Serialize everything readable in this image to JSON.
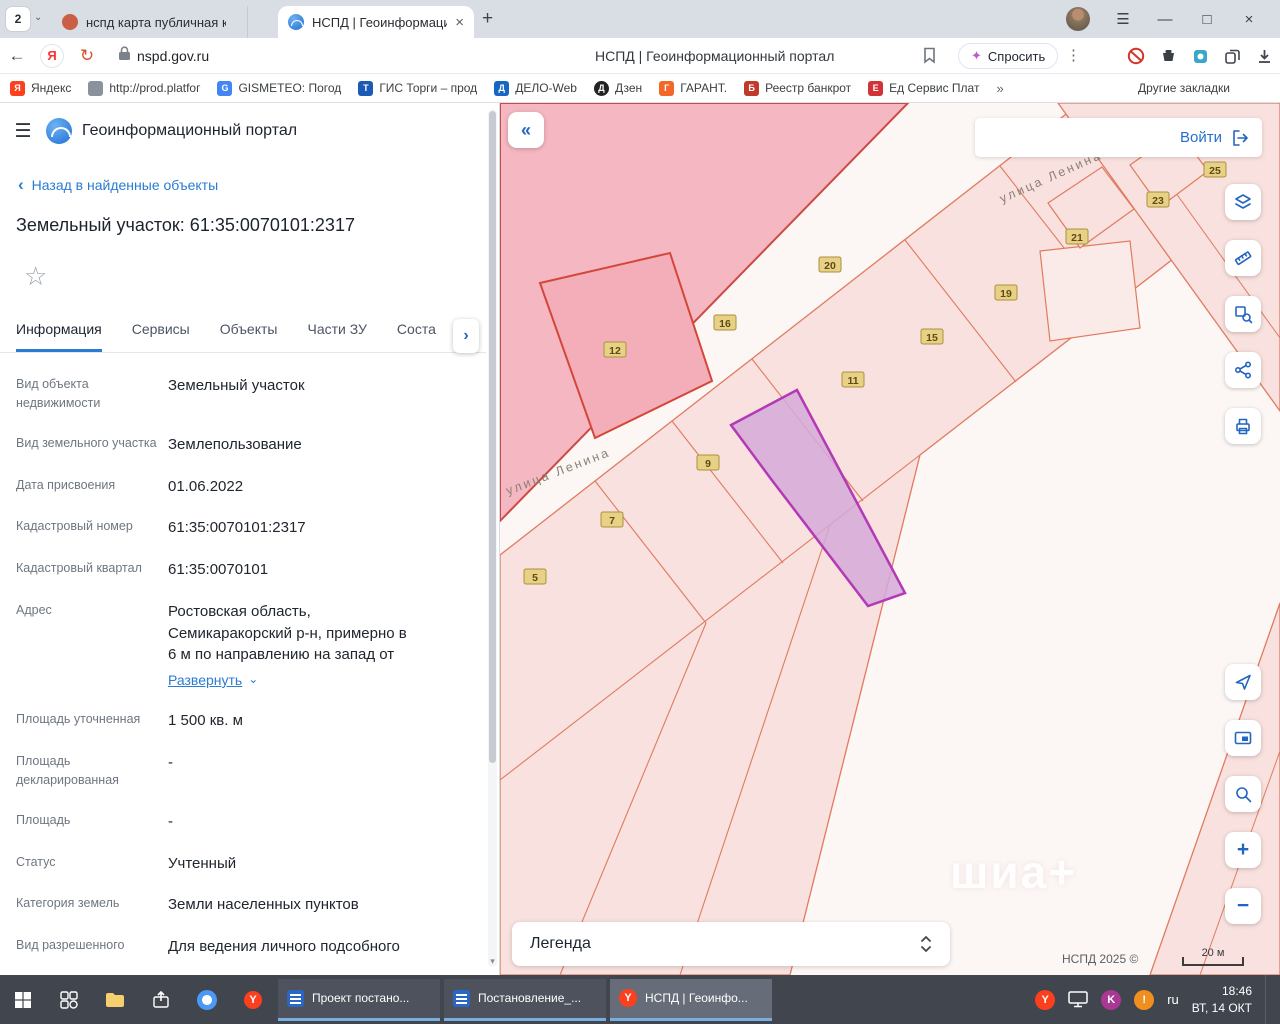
{
  "browser": {
    "tab_counter": "2",
    "tabs": [
      {
        "title": "нспд карта публичная ка...",
        "active": false
      },
      {
        "title": "НСПД | Геоинформаци...",
        "active": true
      }
    ],
    "address": {
      "url": "nspd.gov.ru",
      "page_title": "НСПД | Геоинформационный портал",
      "ask_label": "Спросить"
    },
    "bookmarks": [
      {
        "label": "Яндекс",
        "fav": "Я",
        "color": "#fc3f1d"
      },
      {
        "label": "http://prod.platfoг",
        "fav": "",
        "color": "#8a929c"
      },
      {
        "label": "GISMETEO: Погод",
        "fav": "G",
        "color": "#4285f4"
      },
      {
        "label": "ГИС Торги – прод",
        "fav": "Т",
        "color": "#1b5bb5"
      },
      {
        "label": "ДЕЛО-Web",
        "fav": "Д",
        "color": "#1766c2"
      },
      {
        "label": "Дзен",
        "fav": "Д",
        "color": "#222222"
      },
      {
        "label": "ГАРАНТ.",
        "fav": "Г",
        "color": "#f2682a"
      },
      {
        "label": "Реестр банкрот",
        "fav": "Б",
        "color": "#c0392b"
      },
      {
        "label": "Ед Сервис Плат",
        "fav": "Е",
        "color": "#d13438"
      }
    ],
    "other_bookmarks": "Другие закладки"
  },
  "panel": {
    "app_title": "Геоинформационный портал",
    "back_link": "Назад в найденные объекты",
    "object_title": "Земельный участок: 61:35:0070101:2317",
    "tabs": [
      {
        "label": "Информация",
        "active": true
      },
      {
        "label": "Сервисы",
        "active": false
      },
      {
        "label": "Объекты",
        "active": false
      },
      {
        "label": "Части ЗУ",
        "active": false
      },
      {
        "label": "Соста",
        "active": false
      }
    ],
    "expand_link": "Развернуть",
    "fields": [
      {
        "label": "Вид объекта недвижимости",
        "value": "Земельный участок"
      },
      {
        "label": "Вид земельного участка",
        "value": "Землепользование"
      },
      {
        "label": "Дата присвоения",
        "value": "01.06.2022"
      },
      {
        "label": "Кадастровый номер",
        "value": "61:35:0070101:2317"
      },
      {
        "label": "Кадастровый квартал",
        "value": "61:35:0070101"
      },
      {
        "label": "Адрес",
        "value": "Ростовская область, Семикаракорский р-н, примерно в 6 м по направлению на запад от"
      },
      {
        "label": "Площадь уточненная",
        "value": "1 500 кв. м"
      },
      {
        "label": "Площадь декларированная",
        "value": "-"
      },
      {
        "label": "Площадь",
        "value": "-"
      },
      {
        "label": "Статус",
        "value": "Учтенный"
      },
      {
        "label": "Категория земель",
        "value": "Земли населенных пунктов"
      },
      {
        "label": "Вид разрешенного",
        "value": "Для ведения личного подсобного"
      }
    ]
  },
  "map": {
    "login_label": "Войти",
    "street_label": "улица Ленина",
    "parcel_numbers": [
      "5",
      "7",
      "9",
      "11",
      "12",
      "15",
      "16",
      "19",
      "20",
      "21",
      "23",
      "25"
    ],
    "legend_label": "Легенда",
    "copyright": "НСПД 2025 ©",
    "scale_label": "20 м",
    "watermark": "шиа+"
  },
  "taskbar": {
    "windows": [
      {
        "title": "Проект постано...",
        "active": false
      },
      {
        "title": "Постановление_...",
        "active": false
      },
      {
        "title": "НСПД | Геоинфо...",
        "active": true
      }
    ],
    "lang": "ru",
    "time": "18:46",
    "date": "ВТ, 14 ОКТ"
  },
  "icons": {
    "hamburger": "☰",
    "back_chevron": "‹",
    "star": "☆",
    "tabs_arrow": "›",
    "expand_chevron": "⌄",
    "collapse_panel": "«",
    "more_bookmarks": "»",
    "window_min": "—",
    "window_max": "□",
    "window_close": "×",
    "tab_close": "×",
    "back_arrow": "←",
    "reload": "↻",
    "kebab": "⋮",
    "sparkle": "✦",
    "new_tab": "+",
    "zoom_in": "+",
    "zoom_out": "−",
    "scroll_down": "▾",
    "counter_chevron": "⌄",
    "ya_letter": "Я",
    "y_letter": "Y",
    "k_letter": "K",
    "warn": "!"
  },
  "colors": {
    "accent_blue": "#2465c2",
    "link_blue": "#2a7cd2",
    "parcel_pink": "#f8e1de",
    "parcel_dark_pink": "#f5b7c1",
    "parcel_border": "#e07b60",
    "selected_parcel_fill": "#d5a9d9",
    "selected_parcel_stroke": "#b23ab5",
    "label_yellow": "#e8d186"
  }
}
